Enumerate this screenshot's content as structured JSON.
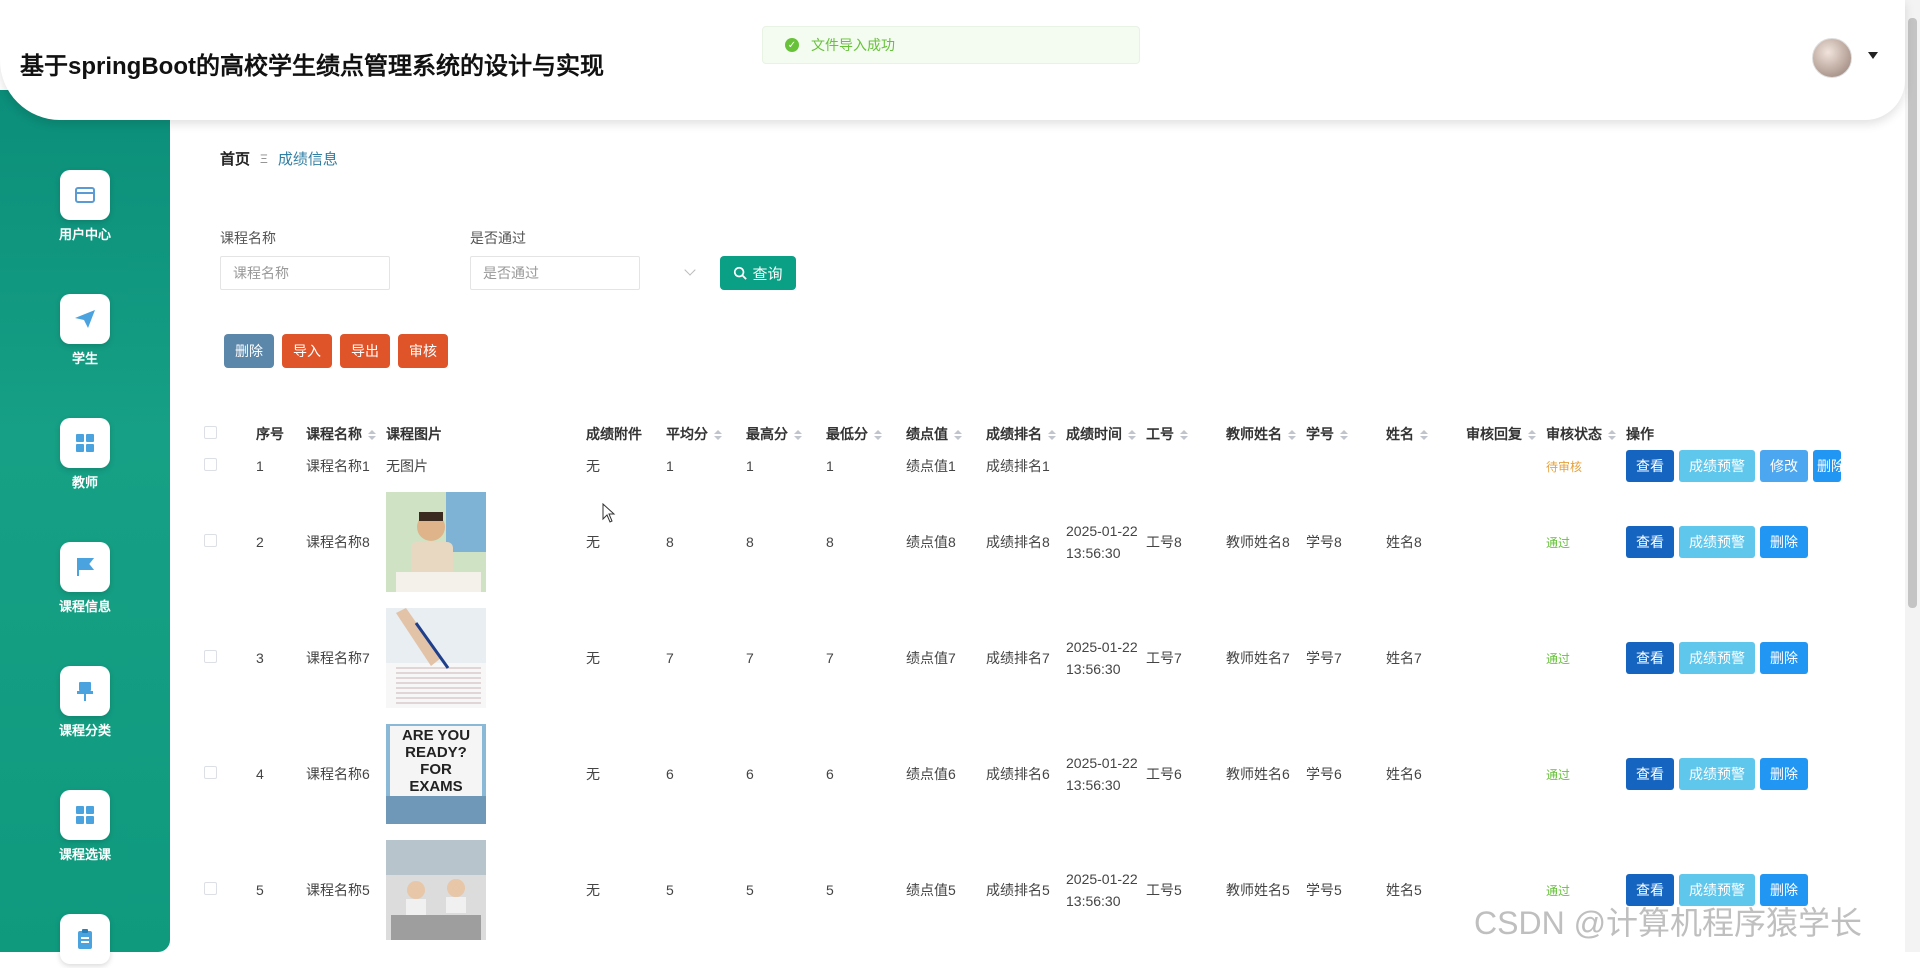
{
  "app": {
    "title": "基于springBoot的高校学生绩点管理系统的设计与实现"
  },
  "toast": {
    "text": "文件导入成功"
  },
  "sidebar": {
    "items": [
      {
        "label": "用户中心",
        "icon": "card-icon"
      },
      {
        "label": "学生",
        "icon": "paper-plane-icon"
      },
      {
        "label": "教师",
        "icon": "grid-icon"
      },
      {
        "label": "课程信息",
        "icon": "flag-icon"
      },
      {
        "label": "课程分类",
        "icon": "pin-icon"
      },
      {
        "label": "课程选课",
        "icon": "grid-icon"
      },
      {
        "label": "",
        "icon": "clipboard-icon"
      }
    ]
  },
  "breadcrumb": {
    "home": "首页",
    "separator": "Ξ",
    "current": "成绩信息"
  },
  "filters": {
    "course_label": "课程名称",
    "course_placeholder": "课程名称",
    "pass_label": "是否通过",
    "pass_placeholder": "是否通过",
    "query_label": "查询"
  },
  "actions": {
    "delete": "删除",
    "import": "导入",
    "export": "导出",
    "audit": "审核"
  },
  "colors": {
    "primary": "#0aa086",
    "sidebar": "#16a085",
    "delete": "#5b87aa",
    "danger": "#e0542a"
  },
  "table": {
    "headers": {
      "index": "序号",
      "course_name": "课程名称",
      "course_image": "课程图片",
      "attachment": "成绩附件",
      "avg": "平均分",
      "max": "最高分",
      "min": "最低分",
      "gpa": "绩点值",
      "rank": "成绩排名",
      "time": "成绩时间",
      "staff_no": "工号",
      "teacher_name": "教师姓名",
      "student_no": "学号",
      "student_name": "姓名",
      "audit_reply": "审核回复",
      "audit_status": "审核状态",
      "ops": "操作"
    },
    "row_buttons": {
      "view": "查看",
      "warn": "成绩预警",
      "edit": "修改",
      "delete": "删除"
    },
    "rows": [
      {
        "index": "1",
        "course": "课程名称1",
        "image": "无图片",
        "attachment": "无",
        "avg": "1",
        "max": "1",
        "min": "1",
        "gpa": "绩点值1",
        "rank": "成绩排名1",
        "time": "",
        "staff": "",
        "teacher": "",
        "sno": "",
        "sname": "",
        "status": "待审核",
        "img": ""
      },
      {
        "index": "2",
        "course": "课程名称8",
        "image": "",
        "attachment": "无",
        "avg": "8",
        "max": "8",
        "min": "8",
        "gpa": "绩点值8",
        "rank": "成绩排名8",
        "time": "2025-01-22 13:56:30",
        "staff": "工号8",
        "teacher": "教师姓名8",
        "sno": "学号8",
        "sname": "姓名8",
        "status": "通过",
        "img": "student-reading"
      },
      {
        "index": "3",
        "course": "课程名称7",
        "image": "",
        "attachment": "无",
        "avg": "7",
        "max": "7",
        "min": "7",
        "gpa": "绩点值7",
        "rank": "成绩排名7",
        "time": "2025-01-22 13:56:30",
        "staff": "工号7",
        "teacher": "教师姓名7",
        "sno": "学号7",
        "sname": "姓名7",
        "status": "通过",
        "img": "exam-sheet"
      },
      {
        "index": "4",
        "course": "课程名称6",
        "image": "",
        "attachment": "无",
        "avg": "6",
        "max": "6",
        "min": "6",
        "gpa": "绩点值6",
        "rank": "成绩排名6",
        "time": "2025-01-22 13:56:30",
        "staff": "工号6",
        "teacher": "教师姓名6",
        "sno": "学号6",
        "sname": "姓名6",
        "status": "通过",
        "img": "ready-sign"
      },
      {
        "index": "5",
        "course": "课程名称5",
        "image": "",
        "attachment": "无",
        "avg": "5",
        "max": "5",
        "min": "5",
        "gpa": "绩点值5",
        "rank": "成绩排名5",
        "time": "2025-01-22 13:56:30",
        "staff": "工号5",
        "teacher": "教师姓名5",
        "sno": "学号5",
        "sname": "姓名5",
        "status": "通过",
        "img": "classroom"
      }
    ]
  },
  "sign_text": {
    "line1": "ARE YOU",
    "line2": "READY?",
    "line3": "FOR",
    "line4": "EXAMS"
  },
  "watermark": "CSDN @计算机程序猿学长"
}
